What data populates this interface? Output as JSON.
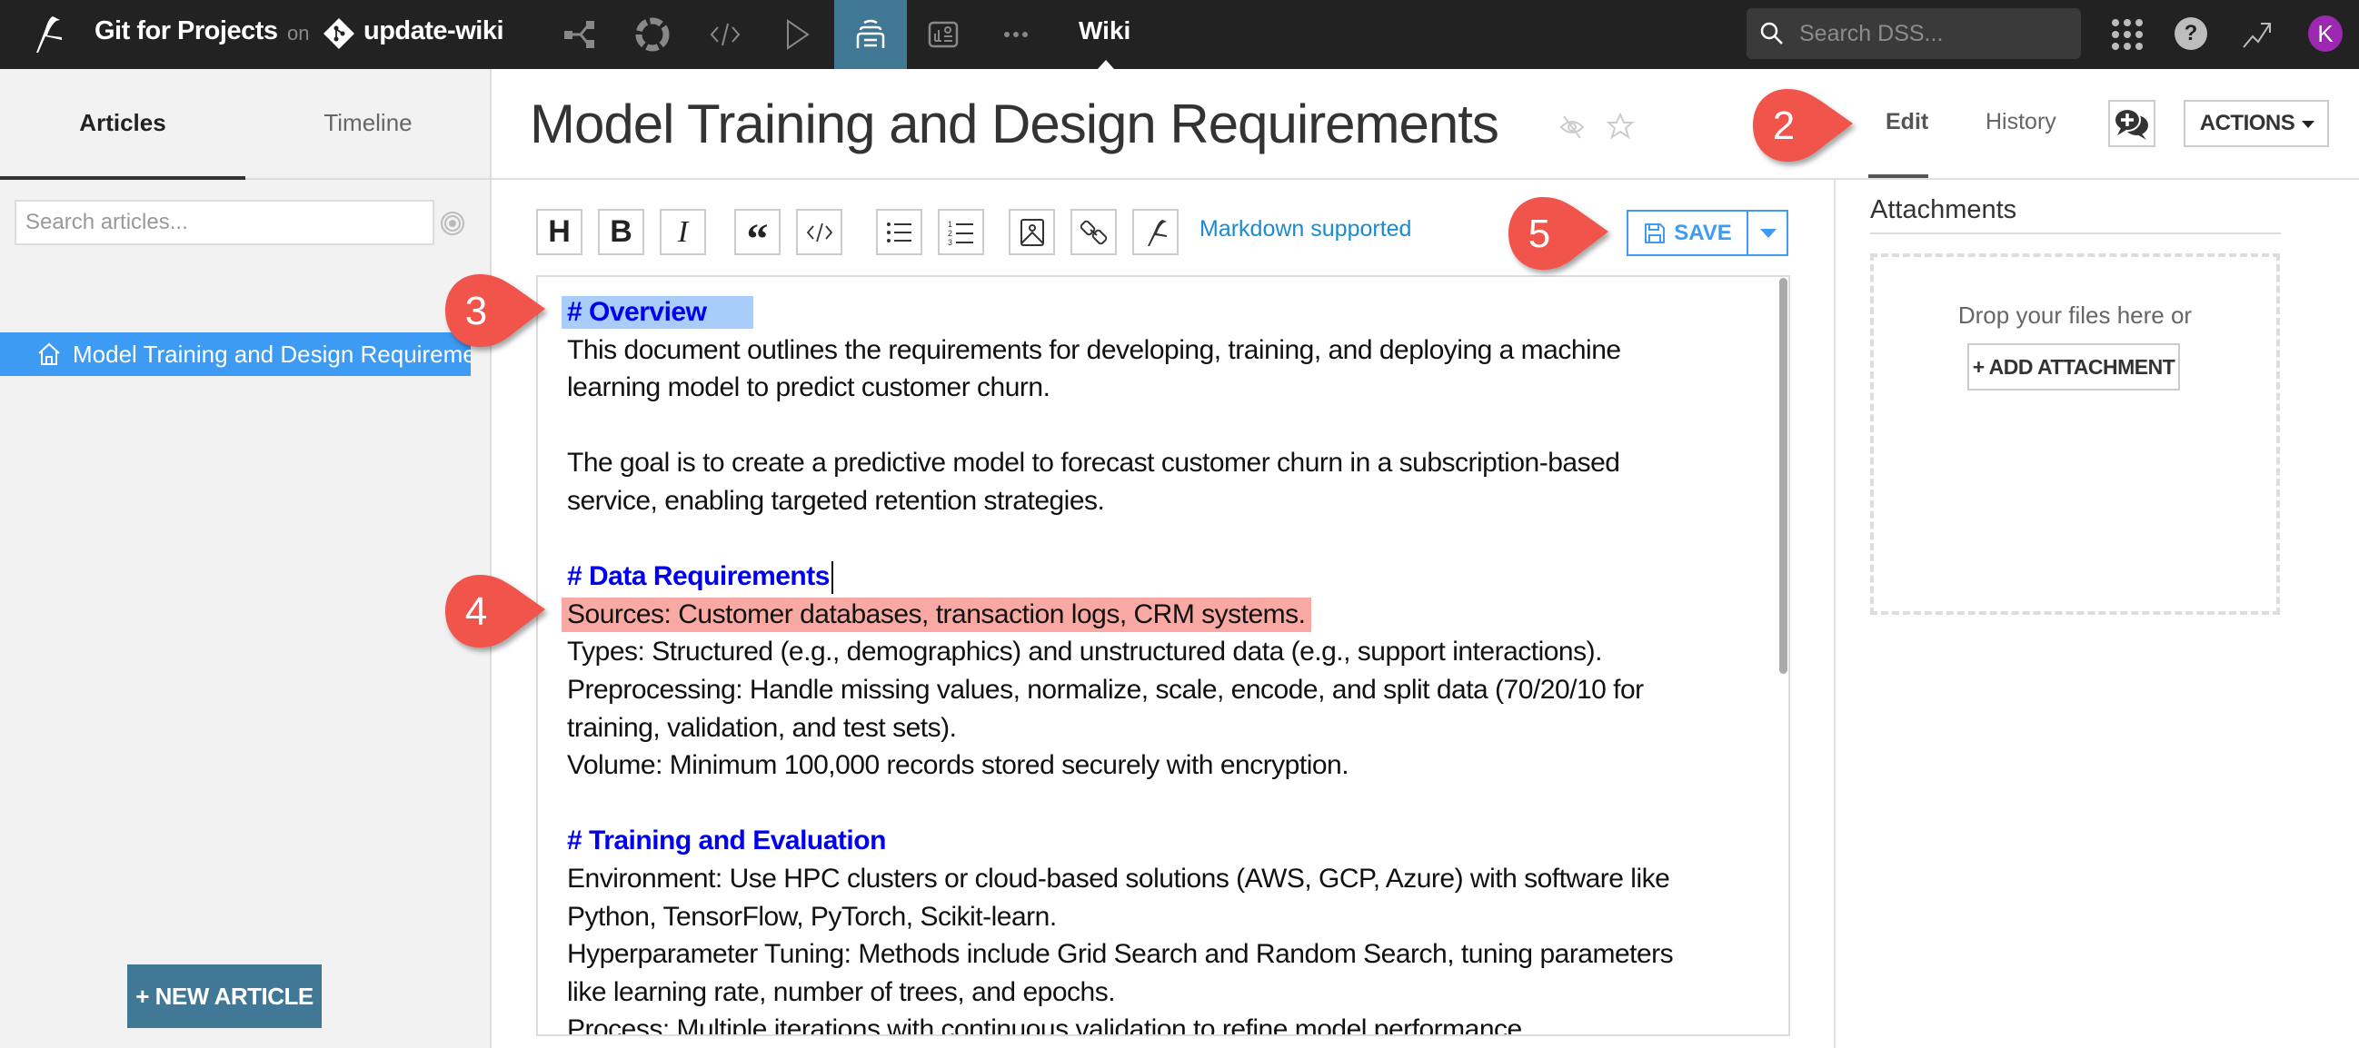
{
  "topbar": {
    "project_name": "Git for Projects",
    "on_label": "on",
    "branch_name": "update-wiki",
    "nav_icons": [
      "flow-icon",
      "lab-icon",
      "code-icon",
      "jobs-icon",
      "wiki-icon",
      "dashboard-icon",
      "more-icon"
    ],
    "active_nav": "wiki-icon",
    "section_label": "Wiki",
    "search_placeholder": "Search DSS...",
    "help_label": "?",
    "avatar_initial": "K"
  },
  "sidebar": {
    "tabs": [
      {
        "label": "Articles",
        "active": true
      },
      {
        "label": "Timeline",
        "active": false
      }
    ],
    "search_placeholder": "Search articles...",
    "articles": [
      {
        "label": "Model Training and Design Requirements",
        "selected": true,
        "icon": "home-icon"
      }
    ],
    "new_article_label": "+ NEW ARTICLE"
  },
  "header": {
    "title": "Model Training and Design Requirements",
    "tabs": [
      {
        "label": "Edit",
        "active": true
      },
      {
        "label": "History",
        "active": false
      }
    ],
    "actions_label": "ACTIONS"
  },
  "toolbar": {
    "buttons": [
      "heading",
      "bold",
      "italic",
      "quote",
      "code",
      "bullet-list",
      "numbered-list",
      "image",
      "link",
      "dataiku-link"
    ],
    "heading_glyph": "H",
    "bold_glyph": "B",
    "italic_glyph": "I",
    "quote_glyph": "“",
    "markdown_label": "Markdown supported",
    "save_label": "SAVE"
  },
  "editor": {
    "lines": [
      {
        "text": "# Overview",
        "type": "heading",
        "highlight": "blue"
      },
      {
        "text": "This document outlines the requirements for developing, training, and deploying a machine",
        "type": "text"
      },
      {
        "text": "learning model to predict customer churn.",
        "type": "text"
      },
      {
        "text": "",
        "type": "blank"
      },
      {
        "text": "The goal is to create a predictive model to forecast customer churn in a subscription-based",
        "type": "text"
      },
      {
        "text": "service, enabling targeted retention strategies.",
        "type": "text"
      },
      {
        "text": "",
        "type": "blank"
      },
      {
        "text": "# Data Requirements",
        "type": "heading",
        "cursor": true
      },
      {
        "text": "Sources: Customer databases, transaction logs, CRM systems.",
        "type": "text",
        "highlight": "red"
      },
      {
        "text": "Types: Structured (e.g., demographics) and unstructured data (e.g., support interactions).",
        "type": "text"
      },
      {
        "text": "Preprocessing: Handle missing values, normalize, scale, encode, and split data (70/20/10 for",
        "type": "text"
      },
      {
        "text": "training, validation, and test sets).",
        "type": "text"
      },
      {
        "text": "Volume: Minimum 100,000 records stored securely with encryption.",
        "type": "text"
      },
      {
        "text": "",
        "type": "blank"
      },
      {
        "text": "# Training and Evaluation",
        "type": "heading"
      },
      {
        "text": "Environment: Use HPC clusters or cloud-based solutions (AWS, GCP, Azure) with software like",
        "type": "text"
      },
      {
        "text": "Python, TensorFlow, PyTorch, Scikit-learn.",
        "type": "text"
      },
      {
        "text": "Hyperparameter Tuning: Methods include Grid Search and Random Search, tuning parameters",
        "type": "text"
      },
      {
        "text": "like learning rate, number of trees, and epochs.",
        "type": "text"
      },
      {
        "text": "Process: Multiple iterations with continuous validation to refine model performance.",
        "type": "text"
      }
    ]
  },
  "attachments": {
    "title": "Attachments",
    "drop_text": "Drop your files here or",
    "add_label": "+ ADD ATTACHMENT"
  },
  "callouts": [
    {
      "number": "2",
      "target": "edit-tab"
    },
    {
      "number": "5",
      "target": "save-button"
    },
    {
      "number": "3",
      "target": "overview-heading"
    },
    {
      "number": "4",
      "target": "sources-line"
    }
  ],
  "colors": {
    "topbar_bg": "#222222",
    "accent_teal": "#417895",
    "selection_blue": "#3d9bf3",
    "heading_blue": "#0000ee",
    "callout_red": "#f0544a",
    "avatar_purple": "#9c27b0"
  }
}
